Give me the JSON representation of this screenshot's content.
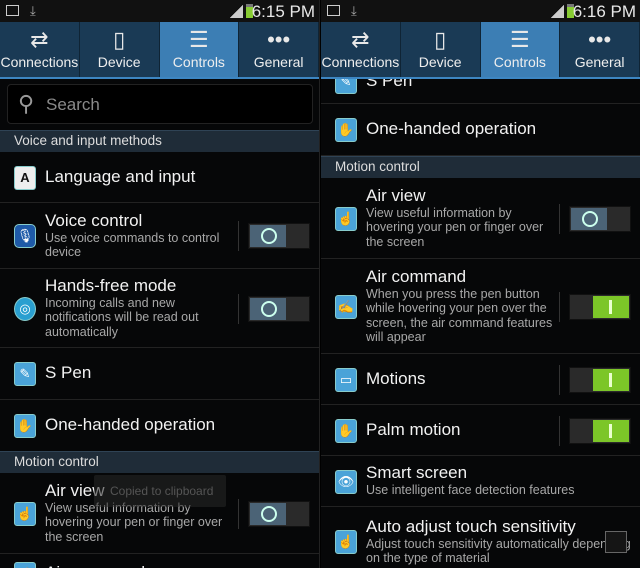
{
  "panels": [
    {
      "time": "6:15 PM",
      "tabs": [
        {
          "label": "Connections",
          "icon": "arrows-swap-icon"
        },
        {
          "label": "Device",
          "icon": "phone-icon"
        },
        {
          "label": "Controls",
          "icon": "sliders-icon",
          "active": true
        },
        {
          "label": "General",
          "icon": "more-dots-icon"
        }
      ],
      "search_placeholder": "Search",
      "toast": "Copied to clipboard",
      "items": [
        {
          "type": "header",
          "title": "Voice and input methods"
        },
        {
          "type": "row",
          "title": "Language and input",
          "icon": "language-icon"
        },
        {
          "type": "row",
          "title": "Voice control",
          "sub": "Use voice commands to control device",
          "icon": "microphone-icon",
          "toggle": "off"
        },
        {
          "type": "row",
          "title": "Hands-free mode",
          "sub": "Incoming calls and new notifications will be read out automatically",
          "icon": "steering-wheel-icon",
          "toggle": "off"
        },
        {
          "type": "row",
          "title": "S Pen",
          "icon": "s-pen-icon"
        },
        {
          "type": "row",
          "title": "One-handed operation",
          "icon": "one-hand-icon"
        },
        {
          "type": "header",
          "title": "Motion control"
        },
        {
          "type": "row",
          "title": "Air view",
          "sub": "View useful information by hovering your pen or finger over the screen",
          "icon": "air-view-icon",
          "toggle": "off"
        },
        {
          "type": "row",
          "title": "Air command",
          "icon": "air-command-icon"
        }
      ]
    },
    {
      "time": "6:16 PM",
      "tabs": [
        {
          "label": "Connections",
          "icon": "arrows-swap-icon"
        },
        {
          "label": "Device",
          "icon": "phone-icon"
        },
        {
          "label": "Controls",
          "icon": "sliders-icon",
          "active": true
        },
        {
          "label": "General",
          "icon": "more-dots-icon"
        }
      ],
      "items": [
        {
          "type": "row",
          "title": "S Pen",
          "icon": "s-pen-icon"
        },
        {
          "type": "row",
          "title": "One-handed operation",
          "icon": "one-hand-icon"
        },
        {
          "type": "header",
          "title": "Motion control"
        },
        {
          "type": "row",
          "title": "Air view",
          "sub": "View useful information by hovering your pen or finger over the screen",
          "icon": "air-view-icon",
          "toggle": "off"
        },
        {
          "type": "row",
          "title": "Air command",
          "sub": "When you press the pen button while hovering your pen over the screen, the air command features will appear",
          "icon": "air-command-icon",
          "toggle": "on"
        },
        {
          "type": "row",
          "title": "Motions",
          "icon": "motions-icon",
          "toggle": "on"
        },
        {
          "type": "row",
          "title": "Palm motion",
          "icon": "palm-motion-icon",
          "toggle": "on"
        },
        {
          "type": "row",
          "title": "Smart screen",
          "sub": "Use intelligent face detection features",
          "icon": "smart-screen-icon"
        },
        {
          "type": "row",
          "title": "Auto adjust touch sensitivity",
          "sub": "Adjust touch sensitivity automatically depending on the type of material",
          "icon": "touch-sensitivity-icon",
          "checkbox": false
        }
      ]
    }
  ]
}
